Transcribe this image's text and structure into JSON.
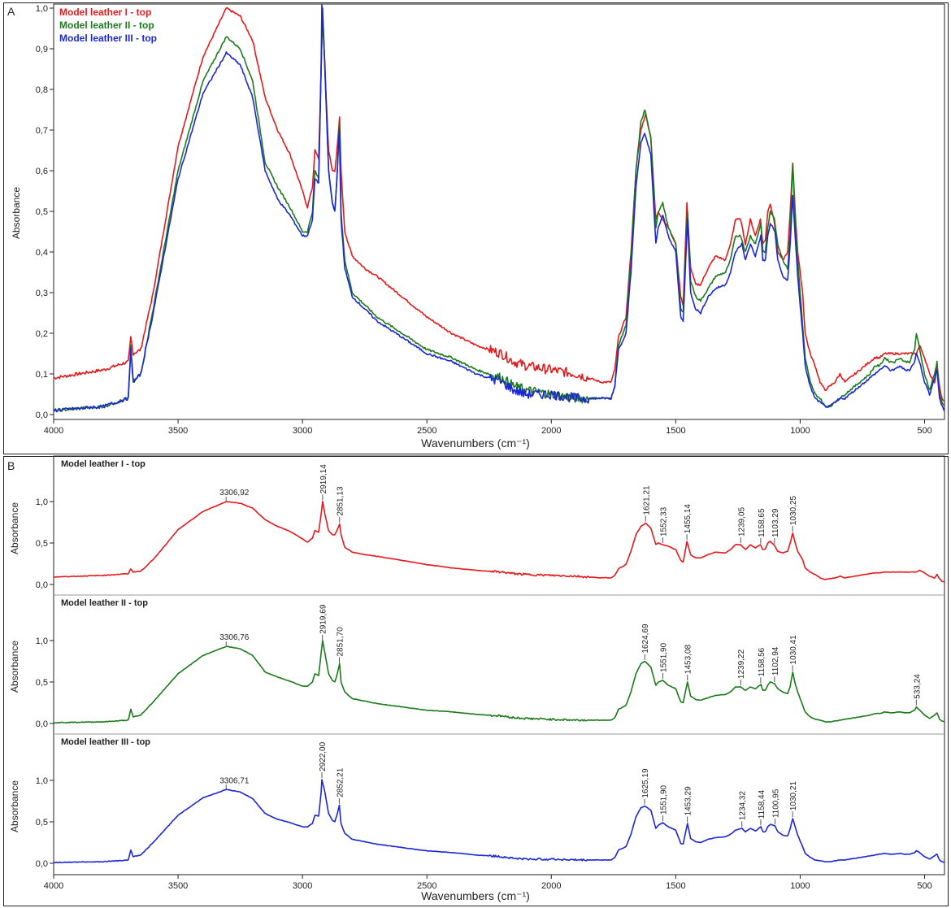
{
  "colors": {
    "series_I": "#e31a1c",
    "series_II": "#1b7a1b",
    "series_III": "#1c27d4",
    "frame": "#222222",
    "axis_text": "#222222"
  },
  "panel_a": {
    "letter": "A",
    "ylabel": "Absorbance",
    "xlabel": "Wavenumbers (cm⁻¹)",
    "xticks": [
      "4000",
      "3500",
      "3000",
      "2500",
      "2000",
      "1500",
      "1000",
      "500"
    ],
    "yticks": [
      "0,0",
      "0,1",
      "0,2",
      "0,3",
      "0,4",
      "0,5",
      "0,6",
      "0,7",
      "0,8",
      "0,9",
      "1,0"
    ],
    "legend": [
      "Model leather I - top",
      "Model leather II - top",
      "Model leather III - top"
    ]
  },
  "panel_b": {
    "letter": "B",
    "xlabel": "Wavenumbers (cm⁻¹)",
    "xticks": [
      "4000",
      "3500",
      "3000",
      "2500",
      "2000",
      "1500",
      "1000",
      "500"
    ],
    "subplots": [
      {
        "title": "Model leather I - top",
        "ylabel": "Absorbance",
        "yticks": [
          "0,0",
          "0,5",
          "1,0"
        ],
        "peaks": [
          "3306,92",
          "2919,14",
          "2851,13",
          "1621,21",
          "1552,33",
          "1455,14",
          "1239,05",
          "1158,65",
          "1103,29",
          "1030,25"
        ]
      },
      {
        "title": "Model leather II - top",
        "ylabel": "Absorbance",
        "yticks": [
          "0,0",
          "0,5",
          "1,0"
        ],
        "peaks": [
          "3306,76",
          "2919,69",
          "2851,70",
          "1624,69",
          "1551,90",
          "1453,08",
          "1239,22",
          "1158,56",
          "1102,94",
          "1030,41",
          "533,24"
        ]
      },
      {
        "title": "Model leather III - top",
        "ylabel": "Absorbance",
        "yticks": [
          "0,0",
          "0,5",
          "1,0"
        ],
        "peaks": [
          "3306,71",
          "2922,00",
          "2852,21",
          "1625,19",
          "1551,90",
          "1453,29",
          "1234,32",
          "1158,44",
          "1100,95",
          "1030,21"
        ]
      }
    ]
  },
  "chart_data": [
    {
      "type": "line",
      "panel": "A",
      "xlabel": "Wavenumbers (cm⁻¹)",
      "ylabel": "Absorbance",
      "xlim": [
        4000,
        420
      ],
      "ylim": [
        -0.02,
        1.01
      ],
      "x_reversed": true,
      "grid": false,
      "legend_position": "top-left",
      "series": [
        {
          "name": "Model leather I - top",
          "color": "#e31a1c",
          "x": [
            4000,
            3800,
            3700,
            3690,
            3680,
            3650,
            3600,
            3500,
            3400,
            3306,
            3250,
            3200,
            3150,
            3100,
            3050,
            3000,
            2980,
            2960,
            2950,
            2935,
            2925,
            2919,
            2910,
            2895,
            2880,
            2870,
            2860,
            2851,
            2845,
            2830,
            2800,
            2750,
            2700,
            2600,
            2500,
            2400,
            2300,
            2200,
            2150,
            2100,
            2000,
            1900,
            1800,
            1760,
            1745,
            1730,
            1700,
            1680,
            1660,
            1640,
            1621,
            1600,
            1580,
            1570,
            1552,
            1530,
            1500,
            1480,
            1470,
            1455,
            1440,
            1420,
            1400,
            1370,
            1340,
            1300,
            1280,
            1260,
            1239,
            1220,
            1200,
            1180,
            1160,
            1150,
            1140,
            1130,
            1120,
            1103,
            1090,
            1070,
            1050,
            1040,
            1030,
            1020,
            1010,
            1000,
            990,
            980,
            960,
            940,
            920,
            900,
            880,
            860,
            840,
            820,
            800,
            780,
            760,
            740,
            720,
            700,
            680,
            660,
            640,
            620,
            600,
            580,
            560,
            540,
            533,
            520,
            500,
            480,
            460,
            450,
            440,
            430,
            420
          ],
          "y": [
            0.09,
            0.11,
            0.13,
            0.19,
            0.15,
            0.16,
            0.3,
            0.66,
            0.88,
            1.0,
            0.98,
            0.92,
            0.78,
            0.7,
            0.64,
            0.55,
            0.51,
            0.56,
            0.65,
            0.63,
            0.85,
            1.0,
            0.85,
            0.65,
            0.6,
            0.6,
            0.66,
            0.73,
            0.6,
            0.45,
            0.39,
            0.36,
            0.34,
            0.29,
            0.24,
            0.2,
            0.17,
            0.15,
            0.13,
            0.12,
            0.11,
            0.1,
            0.08,
            0.08,
            0.11,
            0.19,
            0.24,
            0.4,
            0.6,
            0.7,
            0.74,
            0.68,
            0.48,
            0.5,
            0.48,
            0.46,
            0.42,
            0.29,
            0.27,
            0.52,
            0.36,
            0.32,
            0.32,
            0.36,
            0.39,
            0.38,
            0.42,
            0.48,
            0.48,
            0.42,
            0.48,
            0.44,
            0.48,
            0.42,
            0.43,
            0.5,
            0.52,
            0.47,
            0.4,
            0.38,
            0.4,
            0.5,
            0.62,
            0.5,
            0.4,
            0.35,
            0.3,
            0.2,
            0.15,
            0.12,
            0.08,
            0.06,
            0.07,
            0.08,
            0.1,
            0.08,
            0.09,
            0.1,
            0.11,
            0.12,
            0.13,
            0.14,
            0.14,
            0.15,
            0.15,
            0.15,
            0.15,
            0.15,
            0.15,
            0.15,
            0.15,
            0.17,
            0.14,
            0.1,
            0.08,
            0.12,
            0.07,
            0.04,
            0.03
          ]
        },
        {
          "name": "Model leather II - top",
          "color": "#1b7a1b",
          "x": [
            4000,
            3800,
            3700,
            3690,
            3680,
            3650,
            3600,
            3500,
            3400,
            3306,
            3250,
            3200,
            3150,
            3100,
            3050,
            3000,
            2980,
            2960,
            2950,
            2935,
            2925,
            2919,
            2910,
            2895,
            2880,
            2870,
            2860,
            2851,
            2845,
            2830,
            2800,
            2750,
            2700,
            2600,
            2500,
            2400,
            2300,
            2200,
            2150,
            2100,
            2000,
            1900,
            1800,
            1760,
            1745,
            1730,
            1700,
            1680,
            1660,
            1640,
            1624,
            1600,
            1580,
            1570,
            1552,
            1530,
            1500,
            1480,
            1470,
            1453,
            1440,
            1420,
            1400,
            1370,
            1340,
            1300,
            1280,
            1260,
            1239,
            1220,
            1200,
            1180,
            1158,
            1150,
            1140,
            1130,
            1120,
            1103,
            1090,
            1070,
            1050,
            1040,
            1030,
            1020,
            1010,
            1000,
            990,
            980,
            960,
            940,
            920,
            900,
            880,
            860,
            840,
            820,
            800,
            780,
            760,
            740,
            720,
            700,
            680,
            660,
            640,
            620,
            600,
            580,
            560,
            540,
            533,
            520,
            500,
            480,
            460,
            450,
            440,
            430,
            420
          ],
          "y": [
            0.01,
            0.02,
            0.04,
            0.17,
            0.08,
            0.1,
            0.26,
            0.6,
            0.82,
            0.93,
            0.9,
            0.82,
            0.62,
            0.56,
            0.51,
            0.45,
            0.45,
            0.5,
            0.6,
            0.58,
            0.85,
            1.0,
            0.85,
            0.6,
            0.52,
            0.5,
            0.6,
            0.72,
            0.5,
            0.38,
            0.3,
            0.27,
            0.24,
            0.2,
            0.16,
            0.14,
            0.11,
            0.09,
            0.07,
            0.06,
            0.05,
            0.04,
            0.04,
            0.04,
            0.07,
            0.17,
            0.22,
            0.38,
            0.6,
            0.72,
            0.75,
            0.68,
            0.46,
            0.5,
            0.52,
            0.46,
            0.42,
            0.26,
            0.25,
            0.5,
            0.33,
            0.29,
            0.28,
            0.31,
            0.34,
            0.35,
            0.38,
            0.44,
            0.44,
            0.4,
            0.44,
            0.42,
            0.47,
            0.4,
            0.4,
            0.46,
            0.5,
            0.48,
            0.42,
            0.38,
            0.36,
            0.45,
            0.62,
            0.48,
            0.38,
            0.3,
            0.22,
            0.14,
            0.08,
            0.05,
            0.04,
            0.02,
            0.02,
            0.03,
            0.04,
            0.05,
            0.06,
            0.07,
            0.08,
            0.09,
            0.1,
            0.12,
            0.12,
            0.14,
            0.13,
            0.13,
            0.14,
            0.13,
            0.13,
            0.16,
            0.2,
            0.16,
            0.1,
            0.06,
            0.1,
            0.13,
            0.05,
            0.03,
            0.02
          ]
        },
        {
          "name": "Model leather III - top",
          "color": "#1c27d4",
          "x": [
            4000,
            3800,
            3700,
            3690,
            3680,
            3650,
            3600,
            3500,
            3400,
            3306,
            3250,
            3200,
            3150,
            3100,
            3050,
            3000,
            2980,
            2960,
            2950,
            2935,
            2925,
            2922,
            2910,
            2895,
            2880,
            2870,
            2860,
            2852,
            2845,
            2830,
            2800,
            2750,
            2700,
            2600,
            2500,
            2400,
            2300,
            2200,
            2150,
            2100,
            2000,
            1900,
            1800,
            1760,
            1745,
            1730,
            1700,
            1680,
            1660,
            1640,
            1625,
            1600,
            1580,
            1570,
            1552,
            1530,
            1500,
            1480,
            1470,
            1453,
            1440,
            1420,
            1400,
            1370,
            1340,
            1300,
            1280,
            1260,
            1234,
            1220,
            1200,
            1180,
            1158,
            1150,
            1140,
            1130,
            1120,
            1101,
            1090,
            1070,
            1050,
            1040,
            1030,
            1020,
            1010,
            1000,
            990,
            980,
            960,
            940,
            920,
            900,
            880,
            860,
            840,
            820,
            800,
            780,
            760,
            740,
            720,
            700,
            680,
            660,
            640,
            620,
            600,
            580,
            560,
            540,
            533,
            520,
            500,
            480,
            460,
            450,
            440,
            430,
            420
          ],
          "y": [
            0.01,
            0.02,
            0.04,
            0.16,
            0.08,
            0.1,
            0.25,
            0.58,
            0.79,
            0.89,
            0.86,
            0.78,
            0.6,
            0.53,
            0.49,
            0.44,
            0.44,
            0.48,
            0.58,
            0.57,
            0.86,
            1.01,
            0.86,
            0.6,
            0.52,
            0.5,
            0.6,
            0.7,
            0.48,
            0.36,
            0.29,
            0.26,
            0.23,
            0.19,
            0.15,
            0.13,
            0.1,
            0.08,
            0.06,
            0.05,
            0.05,
            0.04,
            0.04,
            0.04,
            0.07,
            0.16,
            0.2,
            0.35,
            0.56,
            0.67,
            0.69,
            0.64,
            0.42,
            0.46,
            0.49,
            0.44,
            0.4,
            0.24,
            0.23,
            0.48,
            0.3,
            0.26,
            0.25,
            0.29,
            0.31,
            0.32,
            0.35,
            0.4,
            0.42,
            0.38,
            0.42,
            0.39,
            0.44,
            0.38,
            0.38,
            0.44,
            0.47,
            0.45,
            0.38,
            0.34,
            0.33,
            0.42,
            0.54,
            0.44,
            0.34,
            0.27,
            0.2,
            0.12,
            0.07,
            0.04,
            0.03,
            0.02,
            0.02,
            0.03,
            0.04,
            0.04,
            0.05,
            0.06,
            0.07,
            0.08,
            0.09,
            0.1,
            0.11,
            0.12,
            0.11,
            0.11,
            0.12,
            0.11,
            0.11,
            0.13,
            0.15,
            0.13,
            0.08,
            0.05,
            0.09,
            0.11,
            0.04,
            0.02,
            0.01
          ]
        }
      ]
    },
    {
      "type": "line",
      "panel": "B",
      "xlabel": "Wavenumbers (cm⁻¹)",
      "ylabel": "Absorbance",
      "xlim": [
        4000,
        420
      ],
      "ylim": [
        0,
        1.25
      ],
      "x_reversed": true,
      "stacked_subplots": 3,
      "note": "Same three spectra as panel A, drawn in separate stacked plots with labelled peak positions",
      "series": [
        "Model leather I - top",
        "Model leather II - top",
        "Model leather III - top"
      ]
    }
  ]
}
